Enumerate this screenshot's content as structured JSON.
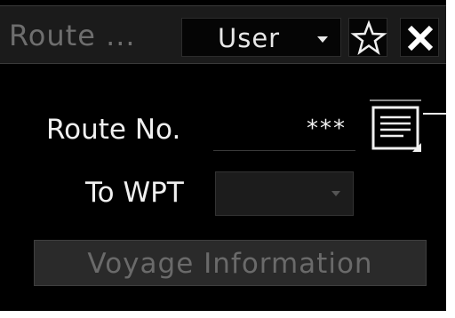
{
  "window": {
    "title": "Route ...",
    "mode_select": {
      "selected": "User"
    }
  },
  "route_section": {
    "route_no_label": "Route No.",
    "route_no_value": "***",
    "to_wpt_label": "To WPT",
    "to_wpt_value": ""
  },
  "actions": {
    "voyage_information_label": "Voyage Information"
  },
  "icons": {
    "star": "star-icon",
    "close": "close-icon",
    "list": "route-list-icon"
  },
  "colors": {
    "background": "#000000",
    "titlebar": "#1b1b1b",
    "text": "#f0f0f0",
    "disabled_text": "#6a6a6a"
  }
}
